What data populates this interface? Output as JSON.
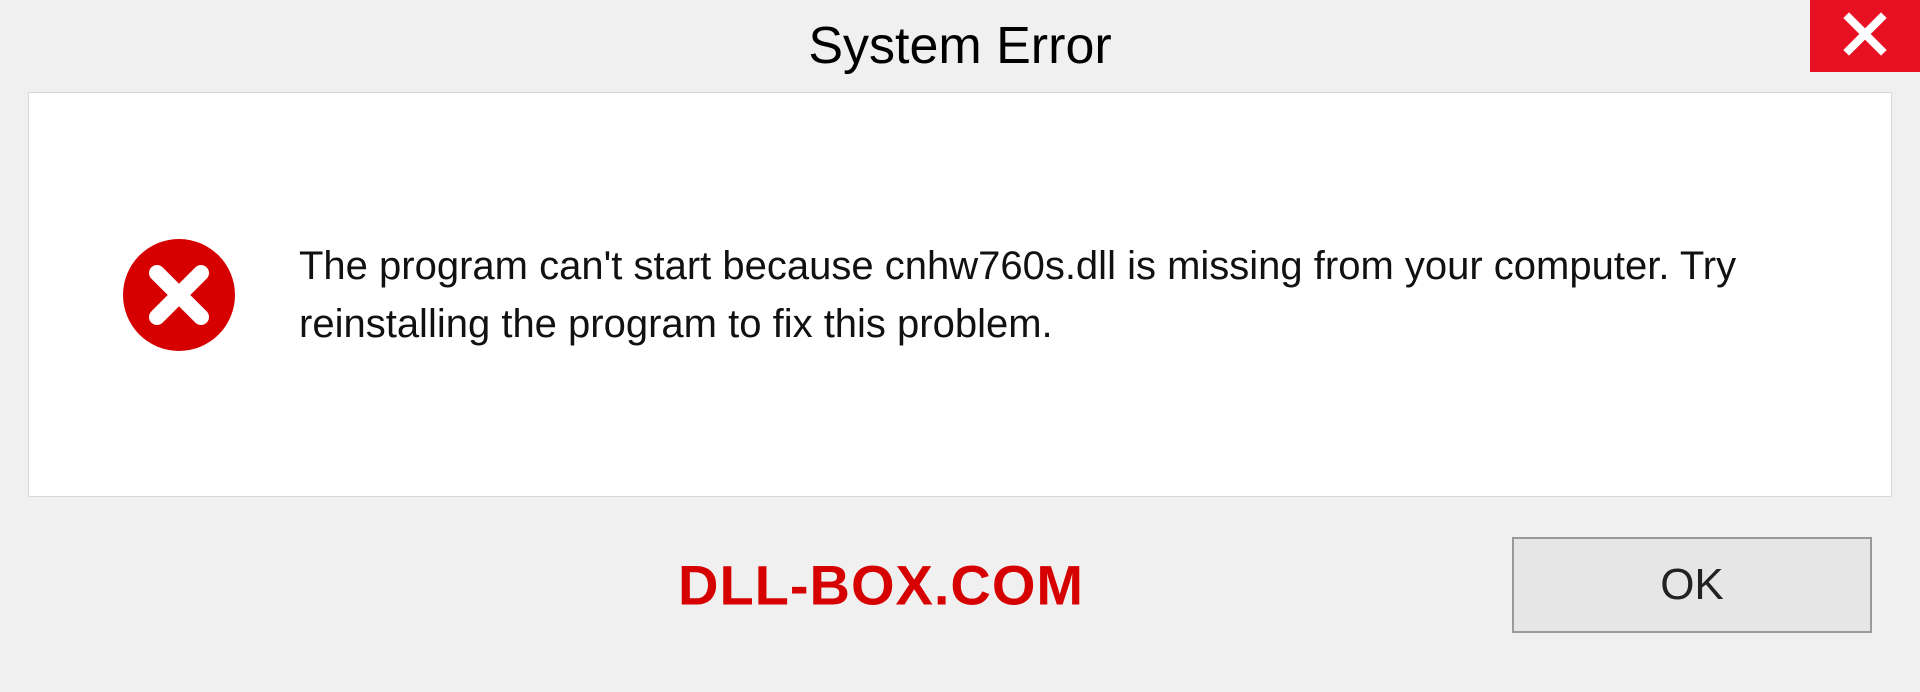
{
  "dialog": {
    "title": "System Error",
    "message": "The program can't start because cnhw760s.dll is missing from your computer. Try reinstalling the program to fix this problem.",
    "ok_label": "OK"
  },
  "watermark": "DLL-BOX.COM"
}
